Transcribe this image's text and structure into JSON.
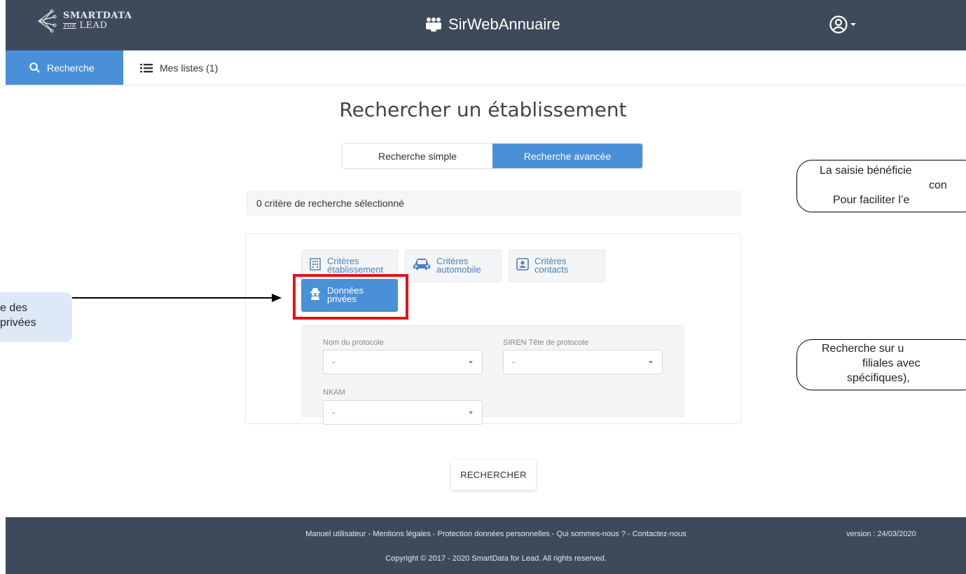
{
  "header": {
    "logo_top": "SMARTDATA",
    "logo_small": "FOR",
    "logo_bottom": "LEAD",
    "app_title": "SirWebAnnuaire"
  },
  "nav": {
    "tabs": [
      {
        "label": "Recherche",
        "icon": "search-icon"
      },
      {
        "label": "Mes listes (1)",
        "icon": "list-icon"
      }
    ]
  },
  "page": {
    "title": "Rechercher un établissement",
    "mode_simple": "Recherche simple",
    "mode_advanced": "Recherche avancée",
    "criteria_count": "0 critère de recherche sélectionné"
  },
  "criteria_tabs": [
    {
      "line1": "Critères",
      "line2": "établissement",
      "icon": "building-icon"
    },
    {
      "line1": "Critères",
      "line2": "automobile",
      "icon": "car-icon"
    },
    {
      "line1": "Critères",
      "line2": "contacts",
      "icon": "contact-card-icon"
    },
    {
      "line1": "Données",
      "line2": "privées",
      "icon": "spy-icon"
    }
  ],
  "form": {
    "protocole_label": "Nom du protocole",
    "protocole_value": "-",
    "siren_label": "SIREN Tête de protocole",
    "siren_value": "-",
    "nkam_label": "NKAM",
    "nkam_value": "-"
  },
  "search_button": "RECHERCHER",
  "footer": {
    "links": "Manuel utilisateur - Mentions légales - Protection données personnelles - Qui sommes-nous ? - Contactez-nous",
    "copyright": "Copyright © 2017 - 2020 SmartData for Lead. All rights reserved.",
    "version": "version : 24/03/2020"
  },
  "annotations": {
    "left_line1": "e des",
    "left_line2": "privées",
    "right1_line1": "La saisie bénéficie",
    "right1_line2": "con",
    "right1_line3": "Pour faciliter l’e",
    "right2_line1": "Recherche sur u",
    "right2_line2": "filiales avec",
    "right2_line3": "spécifiques),"
  },
  "colors": {
    "header_bg": "#3e4a5b",
    "accent": "#4a90d9",
    "highlight": "#e0141c"
  }
}
